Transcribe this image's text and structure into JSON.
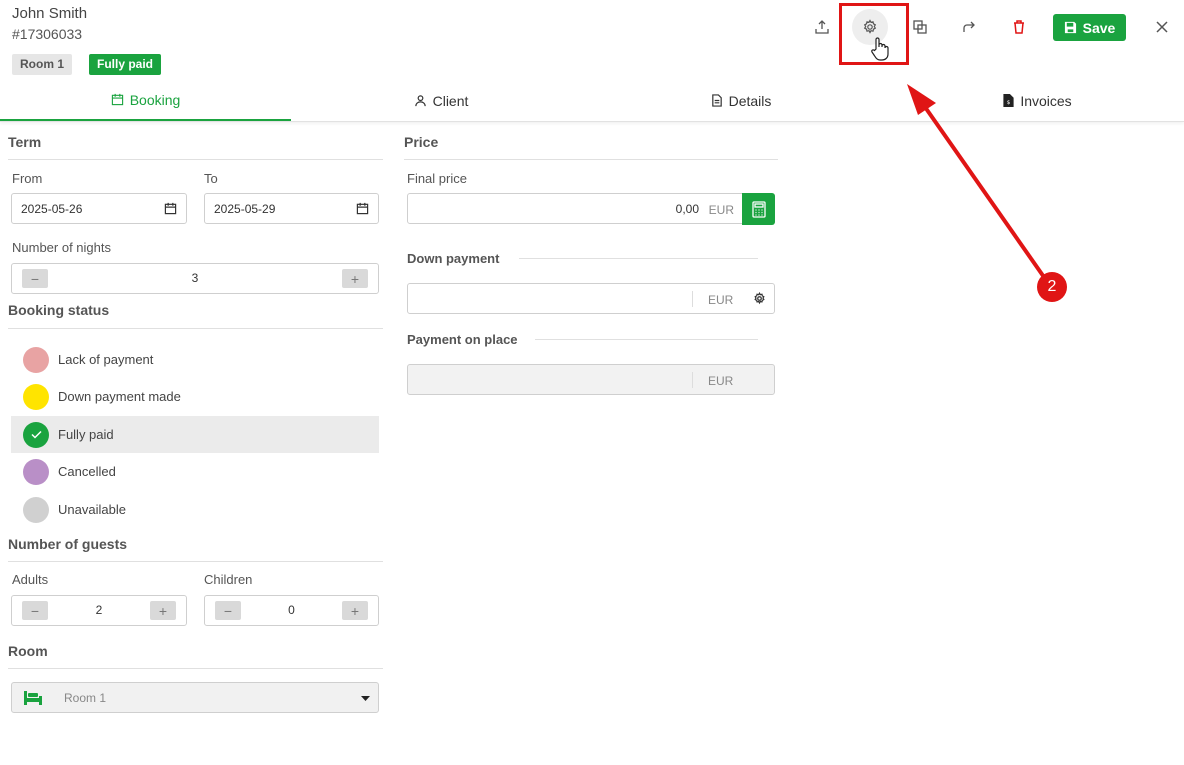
{
  "header": {
    "client_name": "John Smith",
    "booking_id": "#17306033",
    "room_tag": "Room 1",
    "status_tag": "Fully paid",
    "save_label": "Save"
  },
  "tabs": [
    {
      "label": "Booking",
      "icon": "calendar-icon",
      "active": true
    },
    {
      "label": "Client",
      "icon": "person-icon",
      "active": false
    },
    {
      "label": "Details",
      "icon": "document-icon",
      "active": false
    },
    {
      "label": "Invoices",
      "icon": "invoice-icon",
      "active": false
    }
  ],
  "term": {
    "title": "Term",
    "from_label": "From",
    "from_value": "2025-05-26",
    "to_label": "To",
    "to_value": "2025-05-29",
    "nights_label": "Number of nights",
    "nights_value": "3"
  },
  "booking_status": {
    "title": "Booking status",
    "items": [
      {
        "label": "Lack of payment",
        "color": "#e8a3a3",
        "selected": false
      },
      {
        "label": "Down payment made",
        "color": "#ffe400",
        "selected": false
      },
      {
        "label": "Fully paid",
        "color": "#1aa33f",
        "selected": true
      },
      {
        "label": "Cancelled",
        "color": "#b98fc7",
        "selected": false
      },
      {
        "label": "Unavailable",
        "color": "#d0d0d0",
        "selected": false
      }
    ]
  },
  "guests": {
    "title": "Number of guests",
    "adults_label": "Adults",
    "adults_value": "2",
    "children_label": "Children",
    "children_value": "0"
  },
  "room": {
    "title": "Room",
    "selected": "Room 1"
  },
  "price": {
    "title": "Price",
    "final_label": "Final price",
    "final_value": "0,00",
    "currency": "EUR",
    "down_label": "Down payment",
    "down_value": "",
    "onplace_label": "Payment on place",
    "onplace_value": ""
  },
  "annotation": {
    "step": "2",
    "color": "#e01515"
  },
  "colors": {
    "accent": "#1aa33f",
    "danger": "#e01515"
  }
}
